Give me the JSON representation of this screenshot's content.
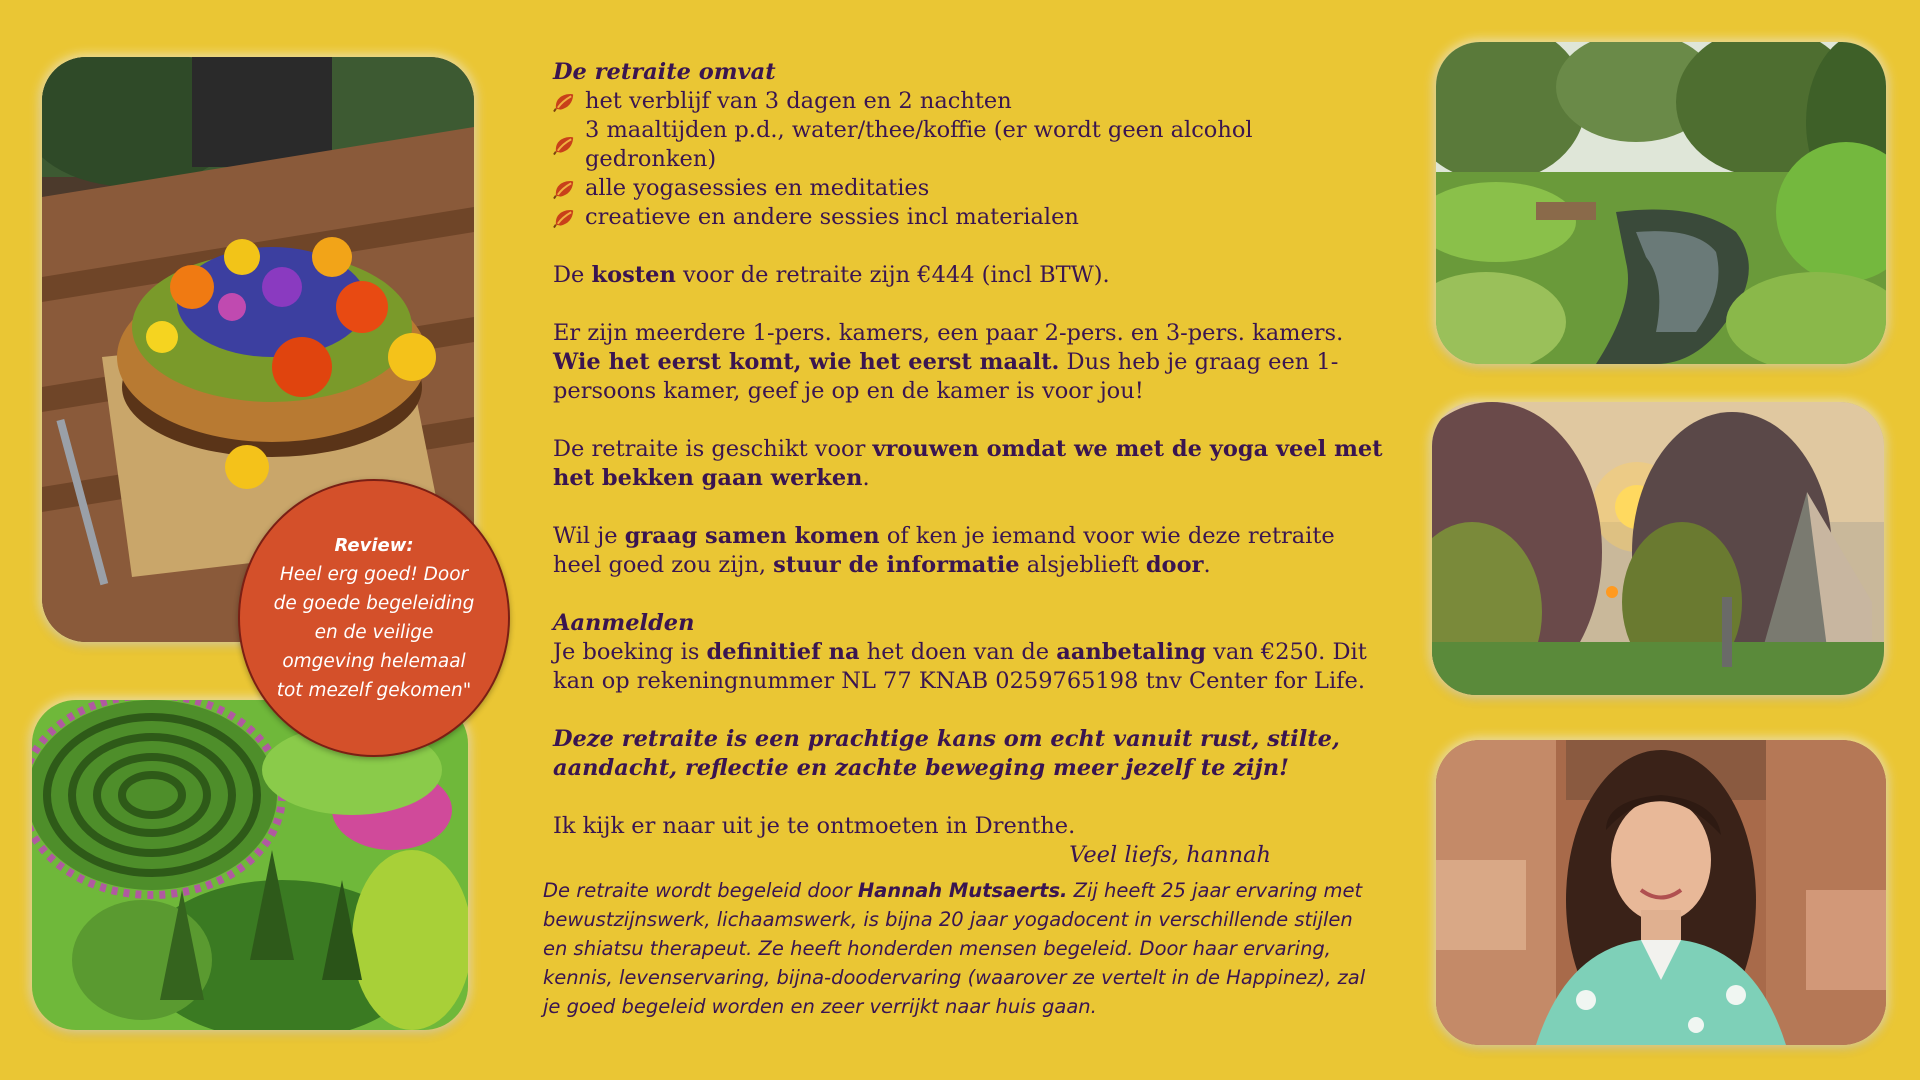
{
  "review": {
    "title": "Review:",
    "lines": [
      "Heel erg goed! Door",
      "de goede begeleiding",
      "en de veilige",
      "omgeving helemaal",
      "tot mezelf gekomen\""
    ]
  },
  "includes": {
    "heading": "De retraite omvat",
    "items": [
      "het verblijf van 3 dagen en 2 nachten",
      "3 maaltijden p.d., water/thee/koffie (er wordt geen alcohol gedronken)",
      "alle yogasessies en meditaties",
      "creatieve en andere sessies incl materialen"
    ],
    "bullet_icon": "leaf-icon"
  },
  "costs": {
    "pre": "De ",
    "bold": "kosten",
    "post": " voor de retraite zijn €444 (incl BTW)."
  },
  "rooms": {
    "line1": "Er zijn meerdere 1-pers. kamers, een paar 2-pers. en 3-pers. kamers.",
    "bold": "Wie het eerst komt, wie het eerst maalt.",
    "rest": " Dus heb je graag een 1-persoons kamer, geef je op en de kamer is voor jou!"
  },
  "suitable": {
    "pre": "De retraite is geschikt voor ",
    "bold": "vrouwen omdat we met de yoga veel met het bekken gaan werken",
    "post": "."
  },
  "share": {
    "p1": "Wil je ",
    "b1": "graag samen komen",
    "p2": " of ken je iemand voor wie deze retraite heel goed zou zijn, ",
    "b2": "stuur de informatie",
    "p3": " alsjeblieft ",
    "b3": "door",
    "p4": "."
  },
  "signup": {
    "heading": "Aanmelden",
    "p1": "Je boeking is ",
    "b1": "definitief na",
    "p2": " het doen van de ",
    "b2": "aanbetaling",
    "p3": " van €250. Dit kan op rekeningnummer NL 77 KNAB 0259765198 tnv Center for Life."
  },
  "highlight": "Deze retraite is een prachtige kans om echt vanuit rust, stilte, aandacht, reflectie en zachte beweging meer jezelf te zijn!",
  "closing": {
    "line": "Ik kijk er naar uit je te ontmoeten in Drenthe.",
    "signoff": "Veel liefs, hannah"
  },
  "bio": {
    "pre": "De retraite wordt begeleid door ",
    "name": "Hannah Mutsaerts.",
    "rest": " Zij heeft 25 jaar ervaring met bewustzijnswerk, lichaamswerk, is bijna 20 jaar yogadocent in verschillende stijlen en shiatsu therapeut. Ze heeft honderden mensen begeleid. Door haar ervaring, kennis, levenservaring, bijna-doodervaring (waarover ze vertelt in de Happinez), zal je goed begeleid worden en zeer verrijkt naar huis gaan."
  },
  "colors": {
    "background": "#eac634",
    "text": "#3a1550",
    "badge": "#d4502a"
  }
}
